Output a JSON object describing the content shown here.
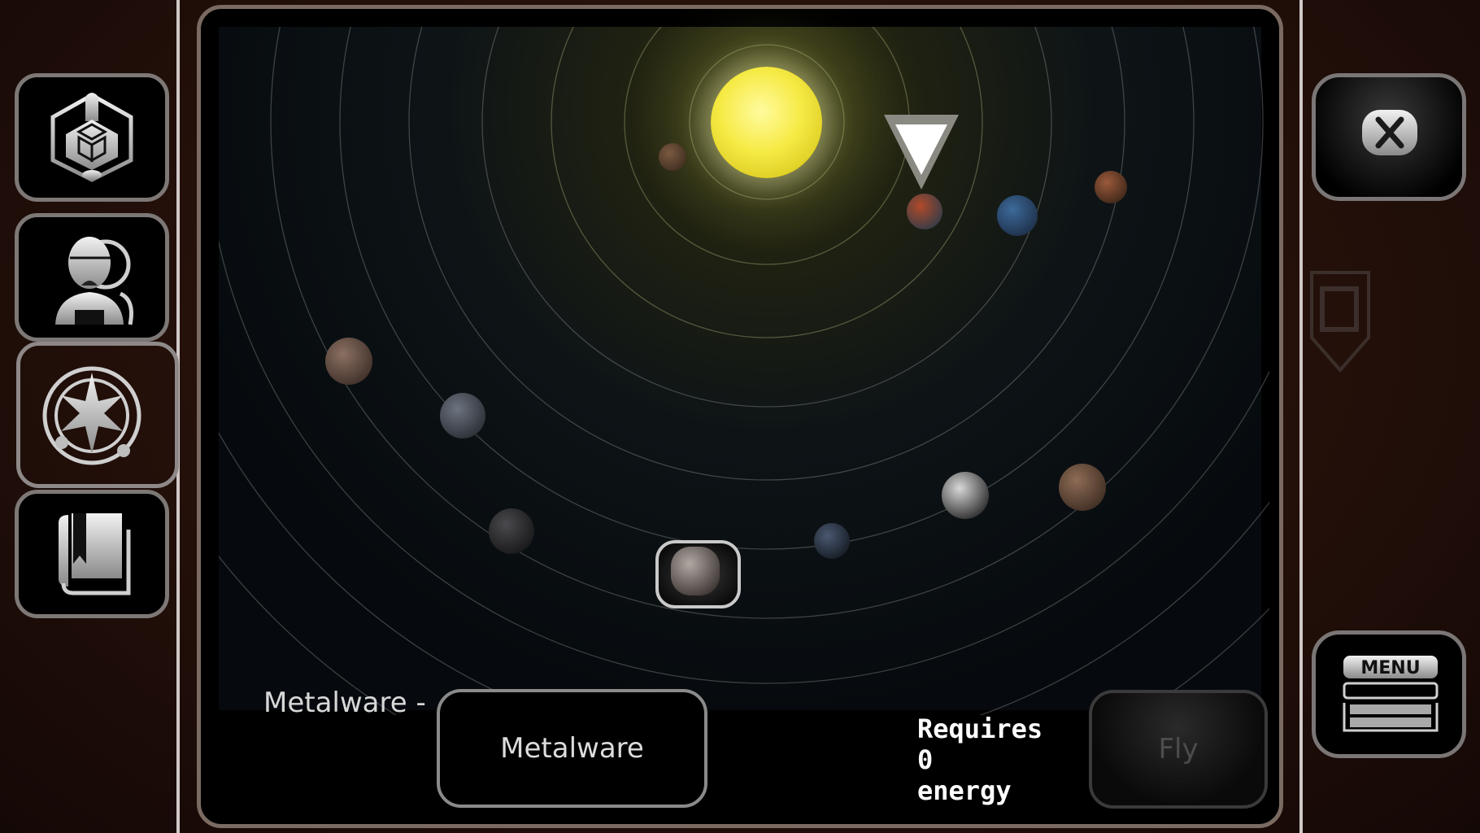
{
  "screen": "star-map",
  "left_toolbar": {
    "items": [
      {
        "id": "ship-builder",
        "icon": "ship-hexagon-icon"
      },
      {
        "id": "crew",
        "icon": "astronaut-icon"
      },
      {
        "id": "star-map",
        "icon": "compass-star-icon",
        "active": true
      },
      {
        "id": "codex",
        "icon": "book-bookmark-icon"
      }
    ]
  },
  "right_toolbar": {
    "close_icon": "close-icon",
    "menu_label": "MENU"
  },
  "star_system": {
    "star": {
      "name": "sun",
      "color": "#f3e640"
    },
    "marker": {
      "icon": "location-triangle-icon",
      "target": "current-location"
    },
    "planets": [
      {
        "id": "p1",
        "kind": "rocky-brown-small",
        "colors": [
          "#7a5a40",
          "#3e2c20"
        ]
      },
      {
        "id": "p2",
        "kind": "lava",
        "colors": [
          "#b04a2a",
          "#2c3b4a"
        ],
        "current": true
      },
      {
        "id": "p3",
        "kind": "earth-like",
        "colors": [
          "#3d6a9a",
          "#1c2c44"
        ]
      },
      {
        "id": "p4",
        "kind": "mars-like",
        "colors": [
          "#9a5a3a",
          "#3a2418"
        ]
      },
      {
        "id": "p5",
        "kind": "asteroid-brown",
        "colors": [
          "#8b7062",
          "#3a2c26"
        ]
      },
      {
        "id": "p6",
        "kind": "grey-moon",
        "colors": [
          "#6d7480",
          "#262a30"
        ]
      },
      {
        "id": "p7",
        "kind": "dark-rock",
        "colors": [
          "#4a4a4e",
          "#141416"
        ]
      },
      {
        "id": "p8",
        "kind": "station",
        "colors": [
          "#b0a8a2",
          "#3a3230"
        ],
        "selected": true
      },
      {
        "id": "p9",
        "kind": "dark-blue",
        "colors": [
          "#4a5870",
          "#121820"
        ]
      },
      {
        "id": "p10",
        "kind": "white-ice",
        "colors": [
          "#d8d8d8",
          "#202020"
        ]
      },
      {
        "id": "p11",
        "kind": "asteroid-brown",
        "colors": [
          "#8e6c56",
          "#3a2a20"
        ]
      }
    ]
  },
  "footer": {
    "destination_label": "Metalware -",
    "destination_button": "Metalware",
    "requires_line1": "Requires",
    "requires_amount": "0",
    "requires_line3": "energy",
    "fly_button": "Fly"
  }
}
